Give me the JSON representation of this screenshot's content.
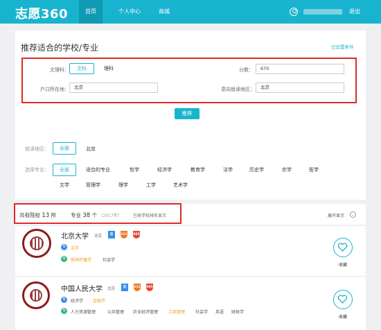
{
  "header": {
    "logo": "志愿360",
    "nav": [
      "首页",
      "个人中心",
      "商城"
    ],
    "logout": "退出"
  },
  "recommend": {
    "title": "推荐适合的学校/专业",
    "set_conditions": "已设置条件",
    "subject_label": "文理科：",
    "subject_options": [
      "文科",
      "理科"
    ],
    "score_label": "分数：",
    "score_value": "670",
    "hukou_label": "户口所在地：",
    "hukou_value": "北京",
    "region_label": "意向就读地区：",
    "region_value": "北京",
    "submit": "推荐"
  },
  "filters": {
    "region_label": "就读地区：",
    "region_all": "全部",
    "region_items": [
      "北京"
    ],
    "major_label": "选择专业：",
    "major_all": "全部",
    "major_row1": [
      "适合的专业",
      "哲学",
      "经济学",
      "教育学",
      "法学",
      "历史学",
      "农学",
      "医学"
    ],
    "major_row2": [
      "文学",
      "管理学",
      "理学",
      "工学",
      "艺术学"
    ]
  },
  "summary": {
    "schools_prefix": "共有院校",
    "schools_count": "13",
    "schools_suffix": "所",
    "majors_prefix": "专业",
    "majors_count": "38",
    "majors_suffix": "个",
    "year": "（2017年）",
    "sort_note": "已按学校排名显示",
    "collapse": "展开显示"
  },
  "universities": [
    {
      "name": "北京大学",
      "city": "北京",
      "badges": [
        "双",
        "211",
        "985"
      ],
      "row1_major": "法学",
      "row2_majors": [
        "新闻传播学",
        "社会学"
      ],
      "fav": "收藏"
    },
    {
      "name": "中国人民大学",
      "city": "北京",
      "badges": [
        "双",
        "211",
        "985"
      ],
      "row1_majors": [
        "经济学",
        "金融学"
      ],
      "row2_majors": [
        "人力资源管理",
        "公共管理",
        "农业经济管理",
        "工商管理",
        "社会学",
        "英语",
        "财政学"
      ],
      "fav": "收藏"
    }
  ],
  "colors": {
    "accent": "#18b4cf",
    "highlight": "#e02828"
  }
}
